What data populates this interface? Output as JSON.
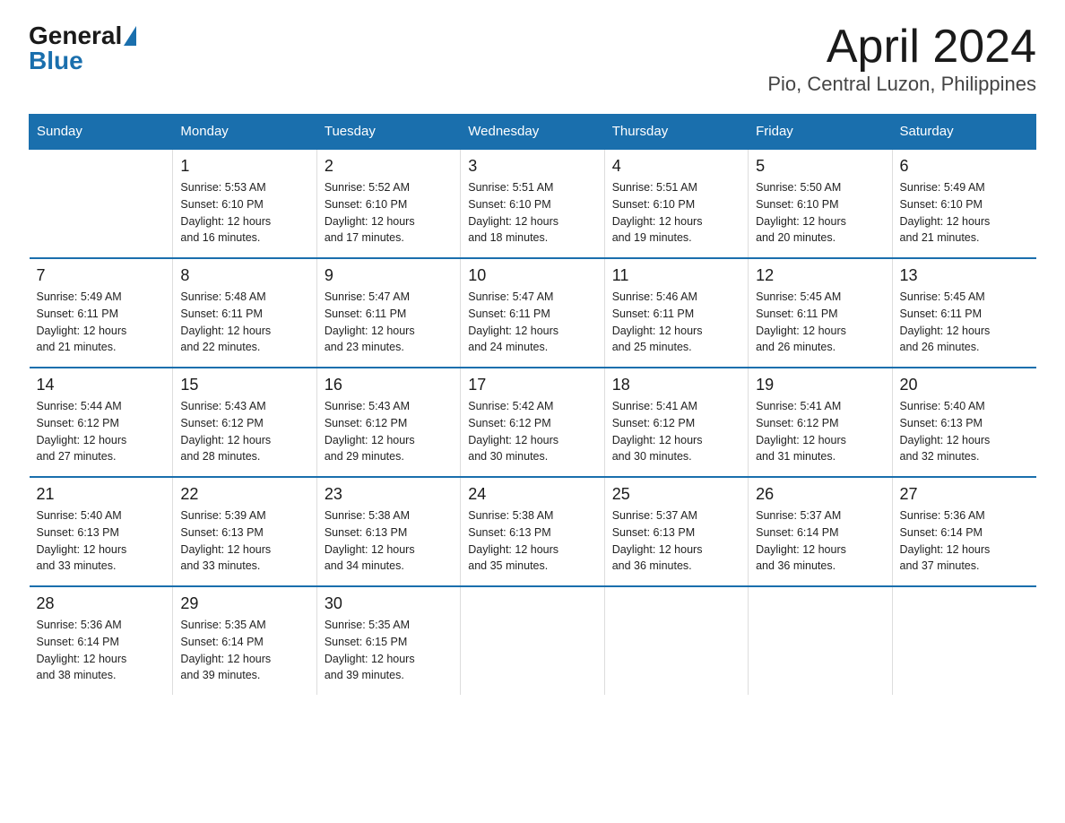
{
  "header": {
    "logo_general": "General",
    "logo_blue": "Blue",
    "title": "April 2024",
    "subtitle": "Pio, Central Luzon, Philippines"
  },
  "days_of_week": [
    "Sunday",
    "Monday",
    "Tuesday",
    "Wednesday",
    "Thursday",
    "Friday",
    "Saturday"
  ],
  "weeks": [
    [
      {
        "day": "",
        "info": ""
      },
      {
        "day": "1",
        "info": "Sunrise: 5:53 AM\nSunset: 6:10 PM\nDaylight: 12 hours\nand 16 minutes."
      },
      {
        "day": "2",
        "info": "Sunrise: 5:52 AM\nSunset: 6:10 PM\nDaylight: 12 hours\nand 17 minutes."
      },
      {
        "day": "3",
        "info": "Sunrise: 5:51 AM\nSunset: 6:10 PM\nDaylight: 12 hours\nand 18 minutes."
      },
      {
        "day": "4",
        "info": "Sunrise: 5:51 AM\nSunset: 6:10 PM\nDaylight: 12 hours\nand 19 minutes."
      },
      {
        "day": "5",
        "info": "Sunrise: 5:50 AM\nSunset: 6:10 PM\nDaylight: 12 hours\nand 20 minutes."
      },
      {
        "day": "6",
        "info": "Sunrise: 5:49 AM\nSunset: 6:10 PM\nDaylight: 12 hours\nand 21 minutes."
      }
    ],
    [
      {
        "day": "7",
        "info": "Sunrise: 5:49 AM\nSunset: 6:11 PM\nDaylight: 12 hours\nand 21 minutes."
      },
      {
        "day": "8",
        "info": "Sunrise: 5:48 AM\nSunset: 6:11 PM\nDaylight: 12 hours\nand 22 minutes."
      },
      {
        "day": "9",
        "info": "Sunrise: 5:47 AM\nSunset: 6:11 PM\nDaylight: 12 hours\nand 23 minutes."
      },
      {
        "day": "10",
        "info": "Sunrise: 5:47 AM\nSunset: 6:11 PM\nDaylight: 12 hours\nand 24 minutes."
      },
      {
        "day": "11",
        "info": "Sunrise: 5:46 AM\nSunset: 6:11 PM\nDaylight: 12 hours\nand 25 minutes."
      },
      {
        "day": "12",
        "info": "Sunrise: 5:45 AM\nSunset: 6:11 PM\nDaylight: 12 hours\nand 26 minutes."
      },
      {
        "day": "13",
        "info": "Sunrise: 5:45 AM\nSunset: 6:11 PM\nDaylight: 12 hours\nand 26 minutes."
      }
    ],
    [
      {
        "day": "14",
        "info": "Sunrise: 5:44 AM\nSunset: 6:12 PM\nDaylight: 12 hours\nand 27 minutes."
      },
      {
        "day": "15",
        "info": "Sunrise: 5:43 AM\nSunset: 6:12 PM\nDaylight: 12 hours\nand 28 minutes."
      },
      {
        "day": "16",
        "info": "Sunrise: 5:43 AM\nSunset: 6:12 PM\nDaylight: 12 hours\nand 29 minutes."
      },
      {
        "day": "17",
        "info": "Sunrise: 5:42 AM\nSunset: 6:12 PM\nDaylight: 12 hours\nand 30 minutes."
      },
      {
        "day": "18",
        "info": "Sunrise: 5:41 AM\nSunset: 6:12 PM\nDaylight: 12 hours\nand 30 minutes."
      },
      {
        "day": "19",
        "info": "Sunrise: 5:41 AM\nSunset: 6:12 PM\nDaylight: 12 hours\nand 31 minutes."
      },
      {
        "day": "20",
        "info": "Sunrise: 5:40 AM\nSunset: 6:13 PM\nDaylight: 12 hours\nand 32 minutes."
      }
    ],
    [
      {
        "day": "21",
        "info": "Sunrise: 5:40 AM\nSunset: 6:13 PM\nDaylight: 12 hours\nand 33 minutes."
      },
      {
        "day": "22",
        "info": "Sunrise: 5:39 AM\nSunset: 6:13 PM\nDaylight: 12 hours\nand 33 minutes."
      },
      {
        "day": "23",
        "info": "Sunrise: 5:38 AM\nSunset: 6:13 PM\nDaylight: 12 hours\nand 34 minutes."
      },
      {
        "day": "24",
        "info": "Sunrise: 5:38 AM\nSunset: 6:13 PM\nDaylight: 12 hours\nand 35 minutes."
      },
      {
        "day": "25",
        "info": "Sunrise: 5:37 AM\nSunset: 6:13 PM\nDaylight: 12 hours\nand 36 minutes."
      },
      {
        "day": "26",
        "info": "Sunrise: 5:37 AM\nSunset: 6:14 PM\nDaylight: 12 hours\nand 36 minutes."
      },
      {
        "day": "27",
        "info": "Sunrise: 5:36 AM\nSunset: 6:14 PM\nDaylight: 12 hours\nand 37 minutes."
      }
    ],
    [
      {
        "day": "28",
        "info": "Sunrise: 5:36 AM\nSunset: 6:14 PM\nDaylight: 12 hours\nand 38 minutes."
      },
      {
        "day": "29",
        "info": "Sunrise: 5:35 AM\nSunset: 6:14 PM\nDaylight: 12 hours\nand 39 minutes."
      },
      {
        "day": "30",
        "info": "Sunrise: 5:35 AM\nSunset: 6:15 PM\nDaylight: 12 hours\nand 39 minutes."
      },
      {
        "day": "",
        "info": ""
      },
      {
        "day": "",
        "info": ""
      },
      {
        "day": "",
        "info": ""
      },
      {
        "day": "",
        "info": ""
      }
    ]
  ]
}
